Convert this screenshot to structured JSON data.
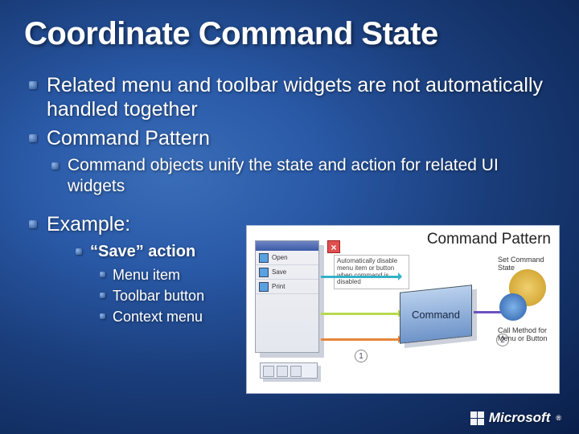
{
  "title": "Coordinate Command State",
  "bullets": {
    "b1": "Related menu and toolbar widgets are not automatically handled together",
    "b2": "Command Pattern",
    "b2_1": "Command objects unify the state and action for related UI widgets",
    "b3": "Example:",
    "b3_1": "“Save” action",
    "b3_1_1": "Menu item",
    "b3_1_2": "Toolbar button",
    "b3_1_3": "Context menu"
  },
  "diagram": {
    "title": "Command Pattern",
    "menu_items": [
      "Open",
      "Save",
      "Print"
    ],
    "tooltip": "Automatically disable menu item or button when command is disabled",
    "command_label": "Command",
    "step1": "1",
    "step2": "2",
    "label_set": "Set Command State",
    "label_call": "Call Method for Menu or Button"
  },
  "footer": {
    "brand": "Microsoft",
    "reg": "®"
  }
}
